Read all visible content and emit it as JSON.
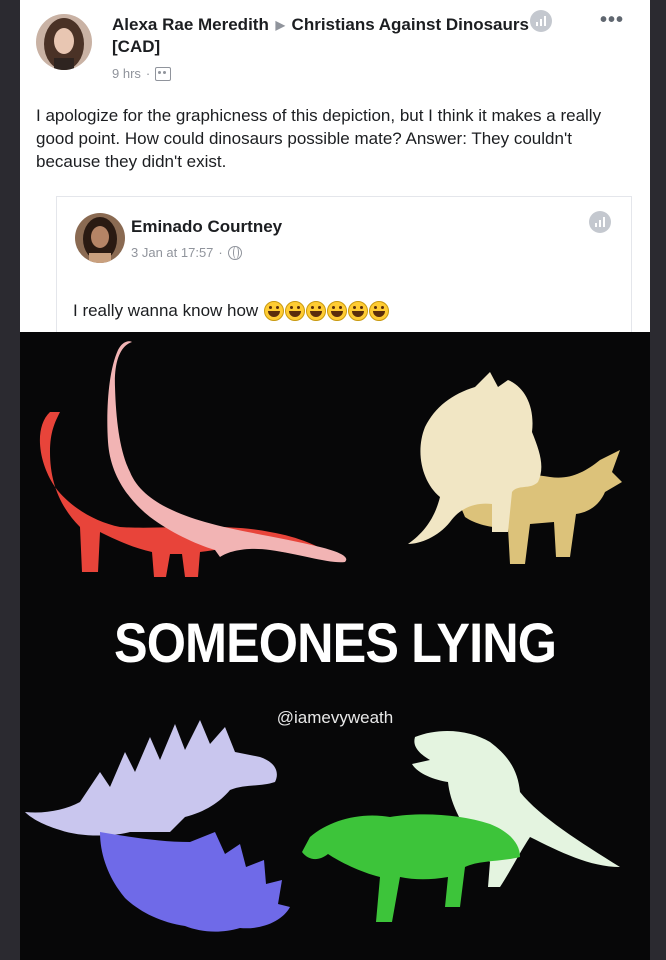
{
  "post": {
    "author": "Alexa Rae Meredith",
    "group": "Christians Against Dinosaurs [CAD]",
    "time": "9 hrs",
    "audience_icon": "group-audience-icon",
    "text": "I apologize for the graphicness of this depiction, but I think it makes a really good point. How could dinosaurs possible mate? Answer: They couldn't because they didn't exist."
  },
  "shared": {
    "author": "Eminado Courtney",
    "time": "3 Jan at 17:57",
    "audience_icon": "globe-icon",
    "text": "I really wanna know how",
    "emoji_count": 6,
    "emoji_icon": "laughing-emoji-icon"
  },
  "meme": {
    "headline": "SOMEONES LYING",
    "handle": "@iamevyweath",
    "colors": {
      "sauropod_top": "#f2b4b4",
      "sauropod_bottom": "#e8443a",
      "triceratops_top": "#f1e6c4",
      "triceratops_bottom": "#dcc27a",
      "stego_top": "#c9c6ee",
      "stego_bottom": "#6f6ae8",
      "trex_top": "#e4f4e0",
      "trex_bottom": "#3dc43a"
    }
  }
}
